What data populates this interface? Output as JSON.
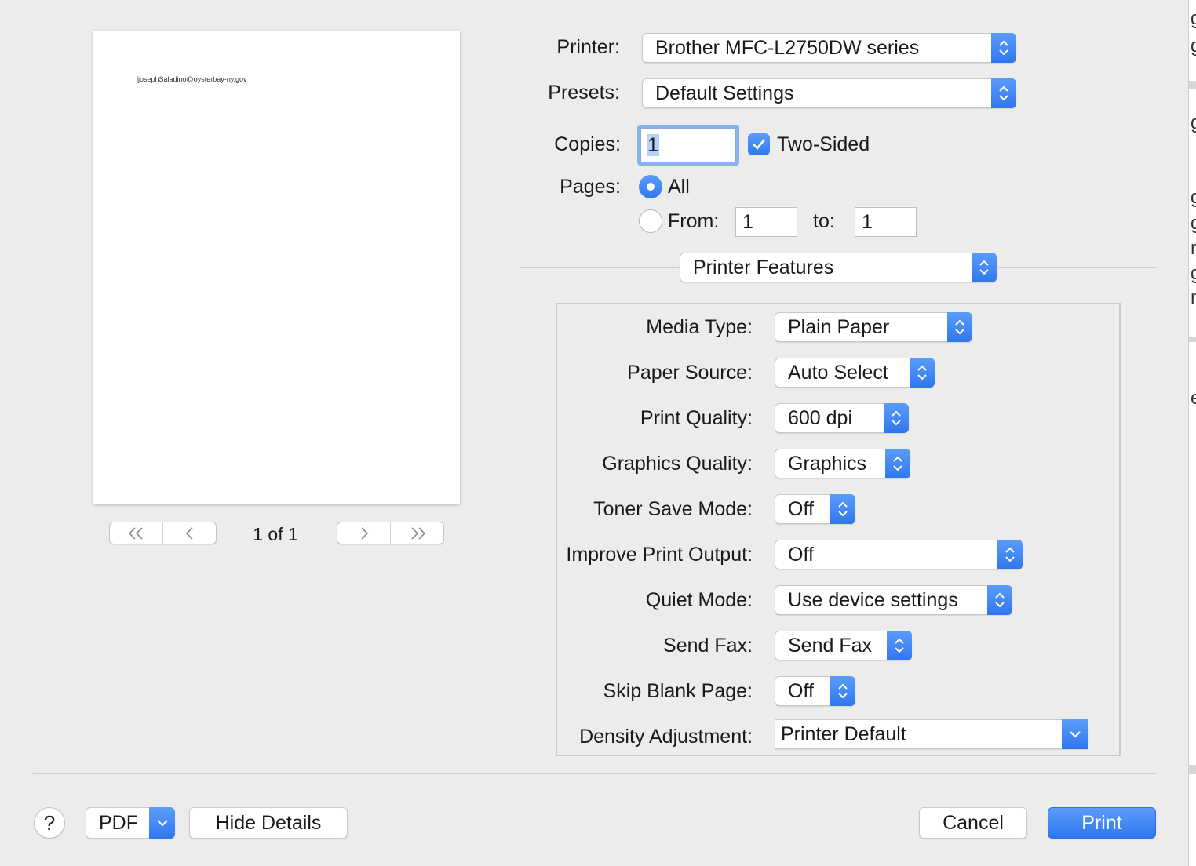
{
  "preview": {
    "page_text": "ljosephSaladino@oysterbay-ny.gov",
    "page_count": "1 of 1",
    "nav_first": "<<",
    "nav_prev": "<",
    "nav_next": ">",
    "nav_last": ">>"
  },
  "general": {
    "printer_label": "Printer:",
    "printer_value": "Brother MFC-L2750DW series",
    "presets_label": "Presets:",
    "presets_value": "Default Settings",
    "copies_label": "Copies:",
    "copies_value": "1",
    "two_sided_label": "Two-Sided",
    "two_sided_checked": true,
    "pages_label": "Pages:",
    "pages_all_label": "All",
    "pages_from_label": "From:",
    "pages_from_value": "1",
    "pages_to_label": "to:",
    "pages_to_value": "1",
    "pages_selected": "All"
  },
  "section_select": "Printer Features",
  "features": [
    {
      "label": "Media Type:",
      "value": "Plain Paper"
    },
    {
      "label": "Paper Source:",
      "value": "Auto Select"
    },
    {
      "label": "Print Quality:",
      "value": "600 dpi"
    },
    {
      "label": "Graphics Quality:",
      "value": "Graphics"
    },
    {
      "label": "Toner Save Mode:",
      "value": "Off"
    },
    {
      "label": "Improve Print Output:",
      "value": "Off"
    },
    {
      "label": "Quiet Mode:",
      "value": "Use device settings"
    },
    {
      "label": "Send Fax:",
      "value": "Send Fax"
    },
    {
      "label": "Skip Blank Page:",
      "value": "Off"
    },
    {
      "label": "Density Adjustment:",
      "value": "Printer Default"
    }
  ],
  "footer": {
    "help_label": "?",
    "pdf_label": "PDF",
    "hide_details_label": "Hide Details",
    "cancel_label": "Cancel",
    "print_label": "Print"
  },
  "background_fragments": [
    "g",
    "g",
    "g",
    "g",
    "g",
    "n",
    "g",
    "n",
    "e"
  ],
  "colors": {
    "accent": "#2f77ee",
    "dialog_bg": "#ececec"
  },
  "icons": {
    "popup_arrows": "updown-chevron-icon",
    "pulldown": "chevron-down-icon",
    "checkbox": "checkmark-icon"
  }
}
